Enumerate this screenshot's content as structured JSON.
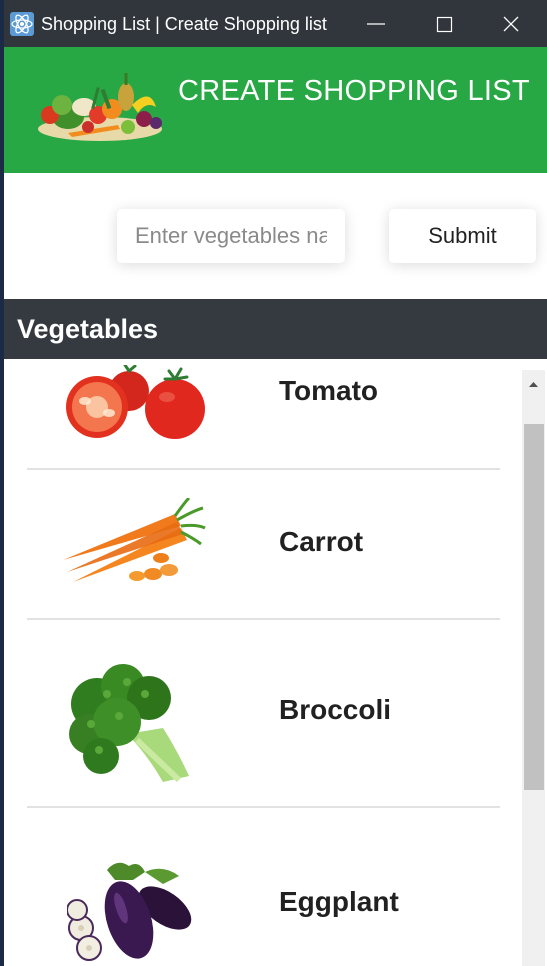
{
  "window": {
    "title": "Shopping List | Create Shopping list",
    "app_icon": "react-atom-icon"
  },
  "header": {
    "title": "CREATE SHOPPING LIST",
    "image": "vegetables-basket"
  },
  "form": {
    "input_placeholder": "Enter vegetables name",
    "input_value": "",
    "submit_label": "Submit"
  },
  "section": {
    "title": "Vegetables"
  },
  "vegetables": [
    {
      "name": "Tomato",
      "image": "tomato"
    },
    {
      "name": "Carrot",
      "image": "carrot"
    },
    {
      "name": "Broccoli",
      "image": "broccoli"
    },
    {
      "name": "Eggplant",
      "image": "eggplant"
    }
  ],
  "colors": {
    "header_green": "#28a745",
    "section_dark": "#343a40",
    "titlebar": "#30363c"
  }
}
